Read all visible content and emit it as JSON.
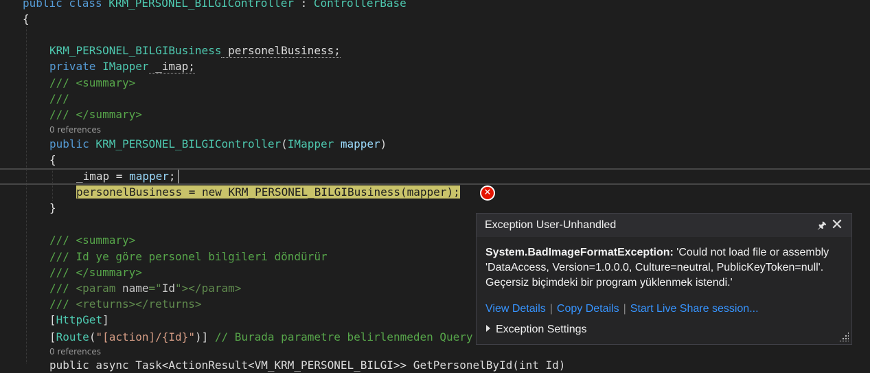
{
  "editor": {
    "lines": {
      "l1_a": "public class ",
      "l1_b": "KRM_PERSONEL_BILGIController",
      "l1_c": " : ",
      "l1_d": "ControllerBase",
      "l2": "{",
      "l3_type": "KRM_PERSONEL_BILGIBusiness",
      "l3_rest": " personelBusiness;",
      "l4_kw": "private",
      "l4_type": " IMapper",
      "l4_rest": " _imap;",
      "l5": "/// <summary>",
      "l6": "///",
      "l7": "/// </summary>",
      "l8_codelens": "0 references",
      "l9_kw": "public",
      "l9_name": " KRM_PERSONEL_BILGIController",
      "l9_open": "(",
      "l9_type": "IMapper",
      "l9_param": " mapper",
      "l9_close": ")",
      "l10": "{",
      "l11_a": "_imap = ",
      "l11_b": "mapper",
      "l11_c": ";",
      "l12": "personelBusiness = new KRM_PERSONEL_BILGIBusiness(mapper);",
      "l13": "}",
      "l14": "/// <summary>",
      "l15": "/// Id ye göre personel bilgileri döndürür",
      "l16": "/// </summary>",
      "l17_a": "/// ",
      "l17_b": "<param ",
      "l17_c": "name",
      "l17_d": "=\"",
      "l17_e": "Id",
      "l17_f": "\"></param>",
      "l18_a": "/// ",
      "l18_b": "<returns></returns>",
      "l19_a": "[",
      "l19_b": "HttpGet",
      "l19_c": "]",
      "l20_a": "[",
      "l20_b": "Route",
      "l20_c": "(",
      "l20_d": "\"[action]/{Id}\"",
      "l20_e": ")]",
      "l20_f": " // Burada parametre belirlenmeden Query",
      "l21_codelens": "0 references",
      "l22": "public async Task<ActionResult<VM_KRM_PERSONEL_BILGI>> GetPersonelById(int Id)"
    }
  },
  "exception_popup": {
    "title": "Exception User-Unhandled",
    "pin_icon": "pin-icon",
    "close_icon": "close-icon",
    "exception_type": "System.BadImageFormatException:",
    "message": " 'Could not load file or assembly 'DataAccess, Version=1.0.0.0, Culture=neutral, PublicKeyToken=null'. Geçersiz biçimdeki bir program yüklenmek istendi.'",
    "links": {
      "view_details": "View Details",
      "copy_details": "Copy Details",
      "live_share": "Start Live Share session..."
    },
    "separator": "|",
    "settings_label": "Exception Settings",
    "error_glyph": "✕"
  },
  "colors": {
    "background": "#1e1e1e",
    "highlight": "#c9c36a",
    "error": "#e51400",
    "link": "#3794ff"
  }
}
